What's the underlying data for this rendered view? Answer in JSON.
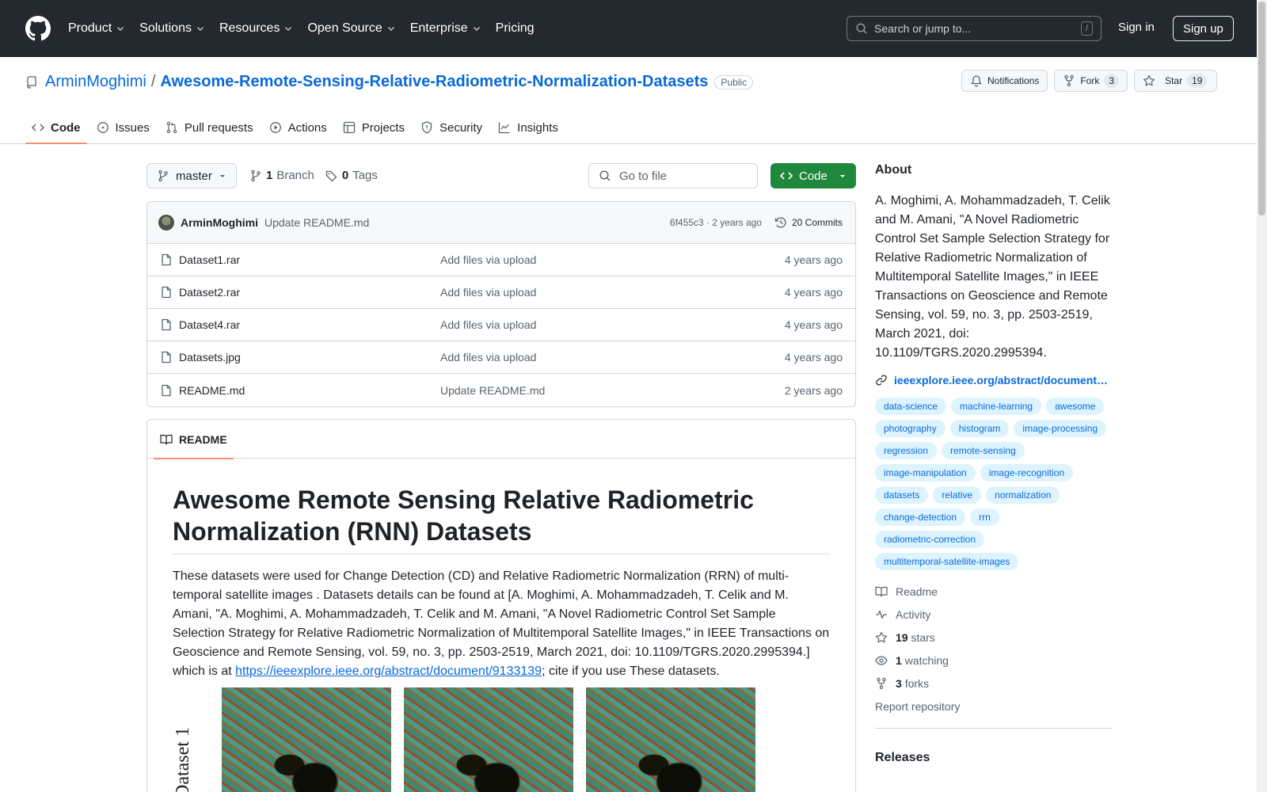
{
  "header": {
    "nav": [
      {
        "label": "Product",
        "dropdown": true
      },
      {
        "label": "Solutions",
        "dropdown": true
      },
      {
        "label": "Resources",
        "dropdown": true
      },
      {
        "label": "Open Source",
        "dropdown": true
      },
      {
        "label": "Enterprise",
        "dropdown": true
      },
      {
        "label": "Pricing",
        "dropdown": false
      }
    ],
    "search_placeholder": "Search or jump to...",
    "search_shortcut": "/",
    "sign_in": "Sign in",
    "sign_up": "Sign up"
  },
  "repo": {
    "owner": "ArminMoghimi",
    "separator": "/",
    "name": "Awesome-Remote-Sensing-Relative-Radiometric-Normalization-Datasets",
    "visibility": "Public",
    "notifications_label": "Notifications",
    "fork_label": "Fork",
    "fork_count": "3",
    "star_label": "Star",
    "star_count": "19"
  },
  "tabs": [
    {
      "label": "Code",
      "icon": "code-icon",
      "active": true
    },
    {
      "label": "Issues",
      "icon": "issue-icon",
      "active": false
    },
    {
      "label": "Pull requests",
      "icon": "pull-request-icon",
      "active": false
    },
    {
      "label": "Actions",
      "icon": "play-icon",
      "active": false
    },
    {
      "label": "Projects",
      "icon": "table-icon",
      "active": false
    },
    {
      "label": "Security",
      "icon": "shield-icon",
      "active": false
    },
    {
      "label": "Insights",
      "icon": "graph-icon",
      "active": false
    }
  ],
  "branchbar": {
    "branch": "master",
    "branch_count": "1",
    "branch_label": "Branch",
    "tag_count": "0",
    "tag_label": "Tags",
    "goto_placeholder": "Go to file",
    "code_button": "Code"
  },
  "commit": {
    "author": "ArminMoghimi",
    "message": "Update README.md",
    "meta": "6f455c3 · 2 years ago",
    "commits": "20 Commits"
  },
  "files": [
    {
      "name": "Dataset1.rar",
      "message": "Add files via upload",
      "date": "4 years ago"
    },
    {
      "name": "Dataset2.rar",
      "message": "Add files via upload",
      "date": "4 years ago"
    },
    {
      "name": "Dataset4.rar",
      "message": "Add files via upload",
      "date": "4 years ago"
    },
    {
      "name": "Datasets.jpg",
      "message": "Add files via upload",
      "date": "4 years ago"
    },
    {
      "name": "README.md",
      "message": "Update README.md",
      "date": "2 years ago"
    }
  ],
  "readme": {
    "tab_label": "README",
    "title": "Awesome Remote Sensing Relative Radiometric Normalization (RNN) Datasets",
    "paragraph_before_link": "These datasets were used for Change Detection (CD) and Relative Radiometric Normalization (RRN) of multi-temporal satellite images . Datasets details can be found at [A. Moghimi, A. Mohammadzadeh, T. Celik and M. Amani, \"A. Moghimi, A. Mohammadzadeh, T. Celik and M. Amani, \"A Novel Radiometric Control Set Sample Selection Strategy for Relative Radiometric Normalization of Multitemporal Satellite Images,\" in IEEE Transactions on Geoscience and Remote Sensing, vol. 59, no. 3, pp. 2503-2519, March 2021, doi: 10.1109/TGRS.2020.2995394.] which is at ",
    "link": "https://ieeexplore.ieee.org/abstract/document/9133139",
    "paragraph_after_link": "; cite if you use These datasets.",
    "figure_label": "Dataset 1"
  },
  "about": {
    "heading": "About",
    "description": "A. Moghimi, A. Mohammadzadeh, T. Celik and M. Amani, \"A Novel Radiometric Control Set Sample Selection Strategy for Relative Radiometric Normalization of Multitemporal Satellite Images,\" in IEEE Transactions on Geoscience and Remote Sensing, vol. 59, no. 3, pp. 2503-2519, March 2021, doi: 10.1109/TGRS.2020.2995394.",
    "website": "ieeexplore.ieee.org/abstract/document…",
    "topics": [
      "data-science",
      "machine-learning",
      "awesome",
      "photography",
      "histogram",
      "image-processing",
      "regression",
      "remote-sensing",
      "image-manipulation",
      "image-recognition",
      "datasets",
      "relative",
      "normalization",
      "change-detection",
      "rrn",
      "radiometric-correction",
      "multitemporal-satellite-images"
    ],
    "readme_label": "Readme",
    "activity_label": "Activity",
    "stars_count": "19",
    "stars_label": "stars",
    "watching_count": "1",
    "watching_label": "watching",
    "forks_count": "3",
    "forks_label": "forks",
    "report_label": "Report repository",
    "releases_heading": "Releases"
  },
  "colors": {
    "header_bg": "#24292f",
    "link": "#0969da",
    "primary_button": "#1f883d",
    "active_tab_underline": "#fd8c73"
  }
}
